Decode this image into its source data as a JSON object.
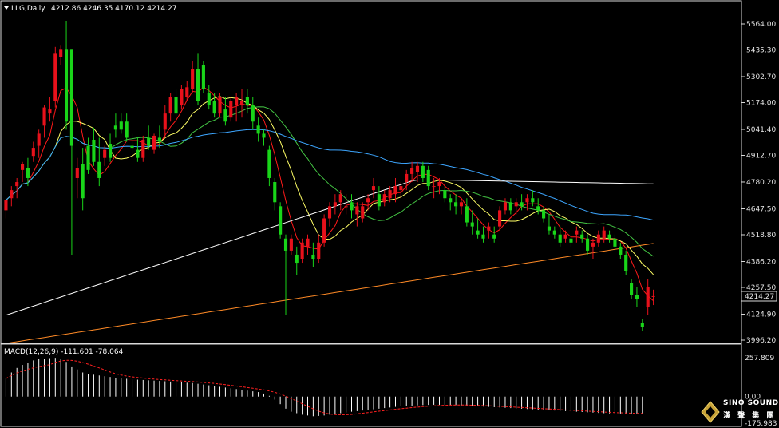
{
  "header": {
    "symbol": "LLG,Daily",
    "ohlc": "4212.86 4246.35 4170.12 4214.27"
  },
  "colors": {
    "up": "#e8111b",
    "down": "#19d519",
    "ma5": "#ff1a1a",
    "ma10": "#ffff66",
    "ma20": "#43c443",
    "ma60": "#3da6ff",
    "ma120": "#ffffff",
    "ma250": "#ff8a26",
    "macd_hist": "#ffffff",
    "macd_signal": "#ff2020",
    "grid": "#d9d9d9"
  },
  "price_axis": {
    "ticks": [
      "5564.00",
      "5435.30",
      "5302.70",
      "5174.00",
      "5041.40",
      "4912.70",
      "4780.20",
      "4647.50",
      "4518.80",
      "4386.20",
      "4257.50",
      "4124.90",
      "3996.20"
    ],
    "current": "4214.27",
    "ylim": [
      3996.2,
      5564.0
    ]
  },
  "macd": {
    "label": "MACD(12,26,9) -111.601 -78.064",
    "ticks": [
      "257.809",
      "0.00",
      "-175.983"
    ],
    "ylim": [
      -175.983,
      257.809
    ]
  },
  "logo": {
    "line1": "SINO SOUND",
    "line2": "漢 聲 集 團"
  },
  "chart_data": {
    "type": "candlestick",
    "title": "LLG,Daily",
    "ylim": [
      3996.2,
      5564.0
    ],
    "candles": [
      [
        4640,
        4700,
        4600,
        4690
      ],
      [
        4700,
        4760,
        4660,
        4740
      ],
      [
        4760,
        4800,
        4700,
        4780
      ],
      [
        4840,
        4880,
        4780,
        4870
      ],
      [
        4850,
        4900,
        4760,
        4800
      ],
      [
        4910,
        4980,
        4880,
        4950
      ],
      [
        4960,
        5040,
        4900,
        5020
      ],
      [
        5060,
        5160,
        5000,
        5150
      ],
      [
        5120,
        5200,
        5080,
        5140
      ],
      [
        5180,
        5450,
        5150,
        5420
      ],
      [
        5400,
        5460,
        5360,
        5440
      ],
      [
        5440,
        5580,
        5040,
        5080
      ],
      [
        5440,
        5440,
        4420,
        4960
      ],
      [
        4800,
        4900,
        4700,
        4850
      ],
      [
        4870,
        4950,
        4640,
        4700
      ],
      [
        4960,
        5000,
        4820,
        4840
      ],
      [
        4990,
        5050,
        4860,
        4880
      ],
      [
        4880,
        5000,
        4760,
        4800
      ],
      [
        4900,
        4960,
        4860,
        4940
      ],
      [
        4970,
        5020,
        4880,
        4900
      ],
      [
        5060,
        5120,
        5000,
        5040
      ],
      [
        5080,
        5120,
        5020,
        5040
      ],
      [
        5080,
        5120,
        4980,
        5000
      ],
      [
        4960,
        5020,
        4920,
        4950
      ],
      [
        4940,
        5000,
        4880,
        4900
      ],
      [
        4900,
        5010,
        4880,
        4990
      ],
      [
        5000,
        5060,
        4940,
        4960
      ],
      [
        4940,
        5020,
        4920,
        5010
      ],
      [
        5000,
        5060,
        4950,
        4980
      ],
      [
        5040,
        5160,
        5000,
        5120
      ],
      [
        5120,
        5220,
        5080,
        5200
      ],
      [
        5200,
        5240,
        5100,
        5120
      ],
      [
        5160,
        5260,
        5140,
        5240
      ],
      [
        5200,
        5280,
        5180,
        5250
      ],
      [
        5240,
        5380,
        5220,
        5340
      ],
      [
        5340,
        5420,
        5160,
        5180
      ],
      [
        5360,
        5380,
        5220,
        5240
      ],
      [
        5220,
        5260,
        5140,
        5160
      ],
      [
        5180,
        5220,
        5100,
        5120
      ],
      [
        5120,
        5220,
        5100,
        5200
      ],
      [
        5140,
        5200,
        5060,
        5080
      ],
      [
        5100,
        5200,
        5080,
        5180
      ],
      [
        5160,
        5220,
        5080,
        5200
      ],
      [
        5160,
        5240,
        5100,
        5180
      ],
      [
        5200,
        5240,
        5120,
        5160
      ],
      [
        5160,
        5200,
        5040,
        5080
      ],
      [
        5060,
        5100,
        4980,
        5020
      ],
      [
        5020,
        5040,
        4960,
        5000
      ],
      [
        4940,
        4960,
        4760,
        4800
      ],
      [
        4780,
        4800,
        4640,
        4680
      ],
      [
        4660,
        4680,
        4500,
        4520
      ],
      [
        4500,
        4520,
        4120,
        4440
      ],
      [
        4440,
        4520,
        4420,
        4500
      ],
      [
        4420,
        4460,
        4320,
        4380
      ],
      [
        4400,
        4500,
        4380,
        4480
      ],
      [
        4460,
        4520,
        4420,
        4500
      ],
      [
        4420,
        4480,
        4360,
        4400
      ],
      [
        4400,
        4520,
        4380,
        4480
      ],
      [
        4480,
        4620,
        4460,
        4600
      ],
      [
        4600,
        4680,
        4560,
        4660
      ],
      [
        4660,
        4720,
        4620,
        4680
      ],
      [
        4680,
        4740,
        4640,
        4720
      ],
      [
        4660,
        4720,
        4620,
        4660
      ],
      [
        4680,
        4720,
        4600,
        4640
      ],
      [
        4620,
        4680,
        4560,
        4660
      ],
      [
        4600,
        4680,
        4580,
        4660
      ],
      [
        4680,
        4720,
        4640,
        4700
      ],
      [
        4740,
        4800,
        4700,
        4760
      ],
      [
        4720,
        4760,
        4640,
        4660
      ],
      [
        4680,
        4740,
        4660,
        4720
      ],
      [
        4700,
        4760,
        4680,
        4740
      ],
      [
        4720,
        4800,
        4680,
        4760
      ],
      [
        4740,
        4780,
        4700,
        4760
      ],
      [
        4780,
        4840,
        4740,
        4820
      ],
      [
        4820,
        4880,
        4780,
        4850
      ],
      [
        4830,
        4880,
        4780,
        4860
      ],
      [
        4860,
        4880,
        4780,
        4800
      ],
      [
        4840,
        4860,
        4740,
        4760
      ],
      [
        4760,
        4800,
        4700,
        4760
      ],
      [
        4760,
        4800,
        4720,
        4780
      ],
      [
        4740,
        4760,
        4680,
        4700
      ],
      [
        4700,
        4720,
        4640,
        4680
      ],
      [
        4680,
        4720,
        4620,
        4660
      ],
      [
        4660,
        4700,
        4620,
        4680
      ],
      [
        4660,
        4700,
        4560,
        4580
      ],
      [
        4580,
        4640,
        4520,
        4560
      ],
      [
        4540,
        4600,
        4500,
        4520
      ],
      [
        4520,
        4560,
        4480,
        4500
      ],
      [
        4540,
        4580,
        4500,
        4560
      ],
      [
        4520,
        4560,
        4480,
        4500
      ],
      [
        4560,
        4660,
        4540,
        4640
      ],
      [
        4640,
        4700,
        4620,
        4680
      ],
      [
        4680,
        4700,
        4620,
        4640
      ],
      [
        4660,
        4700,
        4620,
        4680
      ],
      [
        4680,
        4720,
        4640,
        4660
      ],
      [
        4680,
        4720,
        4640,
        4700
      ],
      [
        4700,
        4740,
        4660,
        4680
      ],
      [
        4660,
        4700,
        4620,
        4640
      ],
      [
        4640,
        4660,
        4580,
        4600
      ],
      [
        4560,
        4620,
        4520,
        4540
      ],
      [
        4540,
        4560,
        4500,
        4520
      ],
      [
        4520,
        4560,
        4460,
        4480
      ],
      [
        4500,
        4540,
        4480,
        4520
      ],
      [
        4500,
        4520,
        4460,
        4480
      ],
      [
        4520,
        4560,
        4480,
        4540
      ],
      [
        4520,
        4540,
        4480,
        4500
      ],
      [
        4500,
        4520,
        4420,
        4440
      ],
      [
        4460,
        4500,
        4400,
        4480
      ],
      [
        4480,
        4540,
        4460,
        4520
      ],
      [
        4500,
        4560,
        4480,
        4540
      ],
      [
        4520,
        4540,
        4480,
        4500
      ],
      [
        4500,
        4520,
        4440,
        4460
      ],
      [
        4460,
        4480,
        4400,
        4420
      ],
      [
        4420,
        4440,
        4320,
        4340
      ],
      [
        4280,
        4300,
        4200,
        4220
      ],
      [
        4220,
        4260,
        4160,
        4200
      ],
      [
        4080,
        4100,
        4040,
        4060
      ],
      [
        4160,
        4300,
        4120,
        4260
      ],
      [
        4212.86,
        4246.35,
        4170.12,
        4214.27
      ]
    ],
    "macd_histogram": [
      120,
      160,
      190,
      210,
      225,
      240,
      248,
      252,
      255,
      257,
      250,
      230,
      200,
      180,
      160,
      150,
      145,
      140,
      135,
      130,
      125,
      120,
      118,
      115,
      112,
      110,
      108,
      106,
      104,
      102,
      100,
      98,
      95,
      92,
      90,
      85,
      80,
      75,
      70,
      65,
      60,
      55,
      50,
      45,
      40,
      35,
      30,
      20,
      5,
      -20,
      -50,
      -80,
      -100,
      -110,
      -120,
      -125,
      -130,
      -128,
      -125,
      -120,
      -115,
      -110,
      -105,
      -100,
      -96,
      -92,
      -88,
      -84,
      -80,
      -76,
      -72,
      -68,
      -65,
      -62,
      -60,
      -58,
      -56,
      -55,
      -54,
      -54,
      -55,
      -56,
      -57,
      -58,
      -60,
      -62,
      -64,
      -66,
      -68,
      -70,
      -72,
      -74,
      -76,
      -78,
      -80,
      -82,
      -84,
      -86,
      -88,
      -90,
      -92,
      -94,
      -96,
      -98,
      -100,
      -102,
      -104,
      -106,
      -108,
      -110,
      -111,
      -112,
      -112,
      -113,
      -113,
      -112,
      -111.601
    ]
  }
}
